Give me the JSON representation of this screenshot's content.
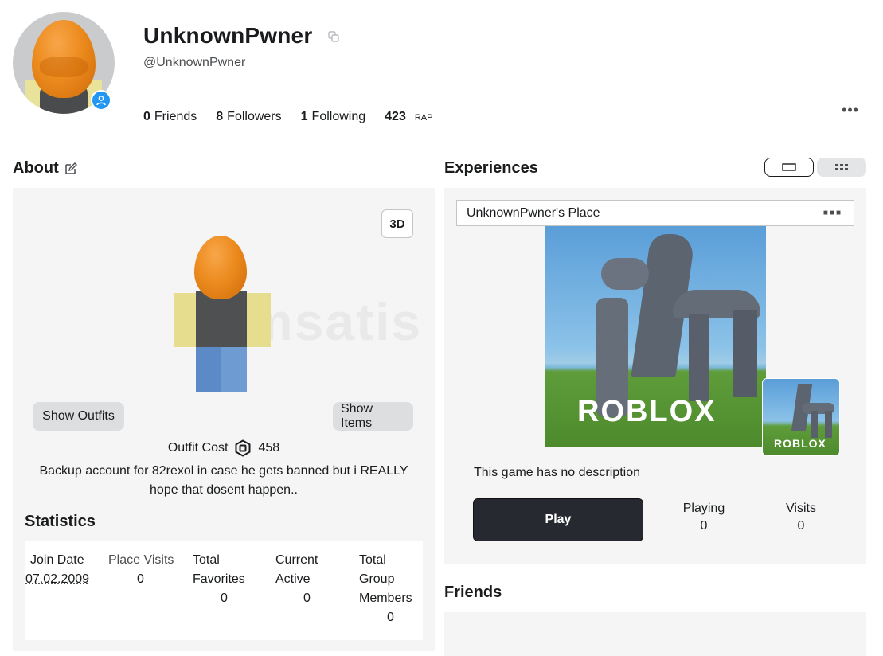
{
  "profile": {
    "display_name": "UnknownPwner",
    "username": "@UnknownPwner",
    "icons": {
      "copy": "copy-icon",
      "presence": "person-icon",
      "more": "more-horizontal-icon"
    },
    "stats": [
      {
        "count": "0",
        "label": "Friends"
      },
      {
        "count": "8",
        "label": "Followers"
      },
      {
        "count": "1",
        "label": "Following"
      },
      {
        "count": "423",
        "label": "RAP"
      }
    ],
    "more_label": "•••"
  },
  "about": {
    "title": "About",
    "edit_icon": "edit-icon",
    "btn_3d": "3D",
    "show_outfits": "Show Outfits",
    "show_items": "Show Items",
    "outfit_cost_label": "Outfit Cost",
    "outfit_cost_value": "458",
    "blurb": "Backup account for 82rexol in case he gets banned but i REALLY hope that dosent happen..",
    "watermark": "itemsatis"
  },
  "statistics": {
    "title": "Statistics",
    "items": [
      {
        "label": "Join Date",
        "value": "07.02.2009"
      },
      {
        "label": "Place Visits",
        "value": "0"
      },
      {
        "label": "Total Favorites",
        "value": "0"
      },
      {
        "label": "Current Active",
        "value": "0"
      },
      {
        "label": "Total Group Members",
        "value": "0"
      }
    ]
  },
  "experiences": {
    "title": "Experiences",
    "game_title": "UnknownPwner's Place",
    "logo_text": "ROBLOX",
    "description": "This game has no description",
    "play_label": "Play",
    "playing_label": "Playing",
    "playing_value": "0",
    "visits_label": "Visits",
    "visits_value": "0"
  },
  "friends": {
    "title": "Friends"
  },
  "colors": {
    "accent_presence": "#2196f3",
    "play_button": "#272930",
    "panel_bg": "#f5f5f5"
  }
}
